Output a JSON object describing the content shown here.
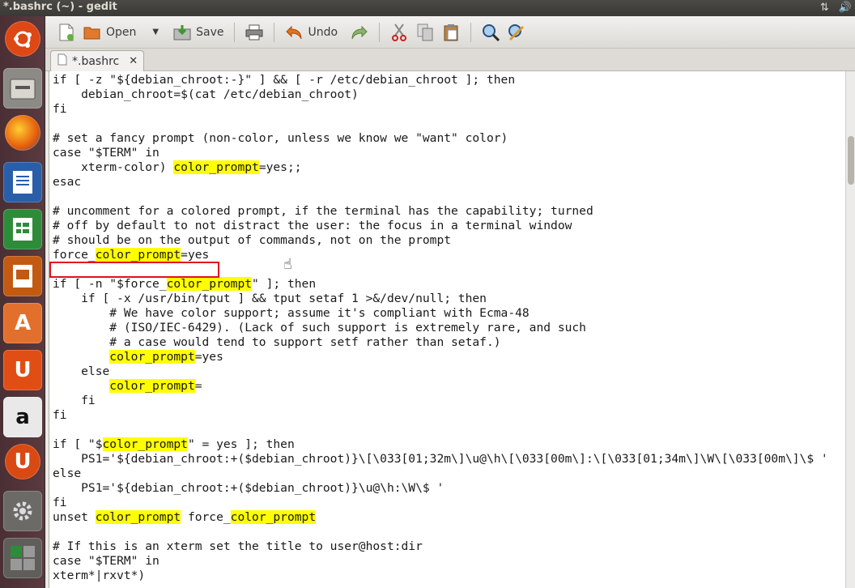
{
  "window_title": "*.bashrc (~) - gedit",
  "toolbar": {
    "open_label": "Open",
    "save_label": "Save",
    "undo_label": "Undo"
  },
  "tab": {
    "label": "*.bashrc",
    "close": "✕"
  },
  "tray": {
    "network": "⇅",
    "volume": "🔊"
  },
  "launcher": {
    "items": [
      "ubuntu-home",
      "files",
      "firefox",
      "writer",
      "calc",
      "impress",
      "software-center",
      "ubuntu-one",
      "amazon",
      "ubuntu-one-music",
      "system-settings"
    ],
    "glyphs": {
      "software-center": "A",
      "ubuntu-one": "U",
      "amazon": "a",
      "ubuntu-one-music": "U"
    }
  },
  "code_lines": [
    "if [ -z \"${debian_chroot:-}\" ] && [ -r /etc/debian_chroot ]; then",
    "    debian_chroot=$(cat /etc/debian_chroot)",
    "fi",
    "",
    "# set a fancy prompt (non-color, unless we know we \"want\" color)",
    "case \"$TERM\" in",
    "    xterm-color) color_prompt=yes;;",
    "esac",
    "",
    "# uncomment for a colored prompt, if the terminal has the capability; turned",
    "# off by default to not distract the user: the focus in a terminal window",
    "# should be on the output of commands, not on the prompt",
    "force_color_prompt=yes",
    "",
    "if [ -n \"$force_color_prompt\" ]; then",
    "    if [ -x /usr/bin/tput ] && tput setaf 1 >&/dev/null; then",
    "        # We have color support; assume it's compliant with Ecma-48",
    "        # (ISO/IEC-6429). (Lack of such support is extremely rare, and such",
    "        # a case would tend to support setf rather than setaf.)",
    "        color_prompt=yes",
    "    else",
    "        color_prompt=",
    "    fi",
    "fi",
    "",
    "if [ \"$color_prompt\" = yes ]; then",
    "    PS1='${debian_chroot:+($debian_chroot)}\\[\\033[01;32m\\]\\u@\\h\\[\\033[00m\\]:\\[\\033[01;34m\\]\\W\\[\\033[00m\\]\\$ '",
    "else",
    "    PS1='${debian_chroot:+($debian_chroot)}\\u@\\h:\\W\\$ '",
    "fi",
    "unset color_prompt force_color_prompt",
    "",
    "# If this is an xterm set the title to user@host:dir",
    "case \"$TERM\" in",
    "xterm*|rxvt*)"
  ],
  "search_highlight": "color_prompt",
  "colors": {
    "highlight": "#ffff00",
    "annotation_box": "#e4111a",
    "launcher_bg": "#4a2f35"
  }
}
